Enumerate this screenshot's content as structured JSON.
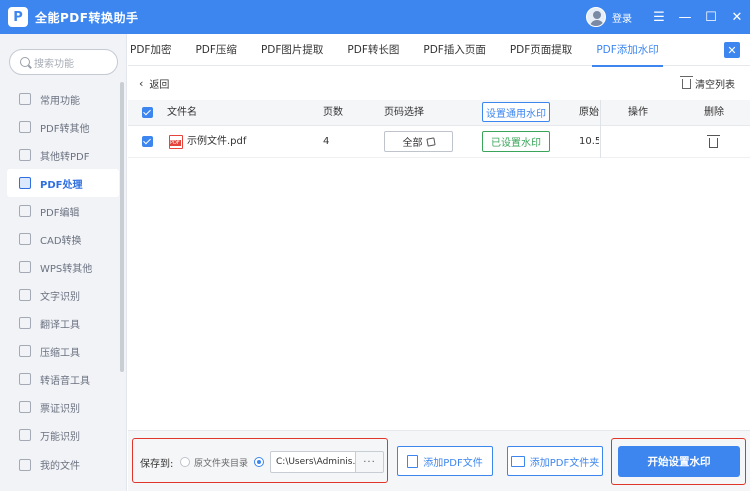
{
  "app": {
    "title": "全能PDF转换助手",
    "login": "登录",
    "logo_letter": "P"
  },
  "window": {
    "menu": "☰",
    "minimize": "—",
    "maximize": "☐",
    "close": "✕"
  },
  "search": {
    "placeholder": "搜索功能"
  },
  "sidebar": {
    "items": [
      {
        "label": "常用功能"
      },
      {
        "label": "PDF转其他"
      },
      {
        "label": "其他转PDF"
      },
      {
        "label": "PDF处理",
        "active": true
      },
      {
        "label": "PDF编辑"
      },
      {
        "label": "CAD转换"
      },
      {
        "label": "WPS转其他"
      },
      {
        "label": "文字识别"
      },
      {
        "label": "翻译工具"
      },
      {
        "label": "压缩工具"
      },
      {
        "label": "转语音工具"
      },
      {
        "label": "票证识别"
      },
      {
        "label": "万能识别"
      }
    ],
    "my_files": "我的文件"
  },
  "tabs": [
    {
      "label": "PDF加密"
    },
    {
      "label": "PDF压缩"
    },
    {
      "label": "PDF图片提取"
    },
    {
      "label": "PDF转长图"
    },
    {
      "label": "PDF插入页面"
    },
    {
      "label": "PDF页面提取"
    },
    {
      "label": "PDF添加水印",
      "active": true
    }
  ],
  "tab_close": "✕",
  "toolbar": {
    "back": "返回",
    "back_chevron": "‹",
    "clear": "清空列表"
  },
  "table": {
    "headers": {
      "filename": "文件名",
      "pages": "页数",
      "page_select": "页码选择",
      "set_watermark": "设置通用水印",
      "original": "原始",
      "ops": "操作",
      "delete": "删除"
    },
    "rows": [
      {
        "filename": "示例文件.pdf",
        "pages": "4",
        "page_select": "全部",
        "watermark_status": "已设置水印",
        "original": "10.5"
      }
    ]
  },
  "bottom": {
    "save_to": "保存到:",
    "option_source": "原文件夹目录",
    "path": "C:\\Users\\Adminis...",
    "browse": "···",
    "add_pdf_file": "添加PDF文件",
    "add_pdf_folder": "添加PDF文件夹",
    "start": "开始设置水印"
  },
  "colors": {
    "primary": "#3d86f0",
    "highlight": "#e0352b",
    "success": "#3aa55a"
  }
}
